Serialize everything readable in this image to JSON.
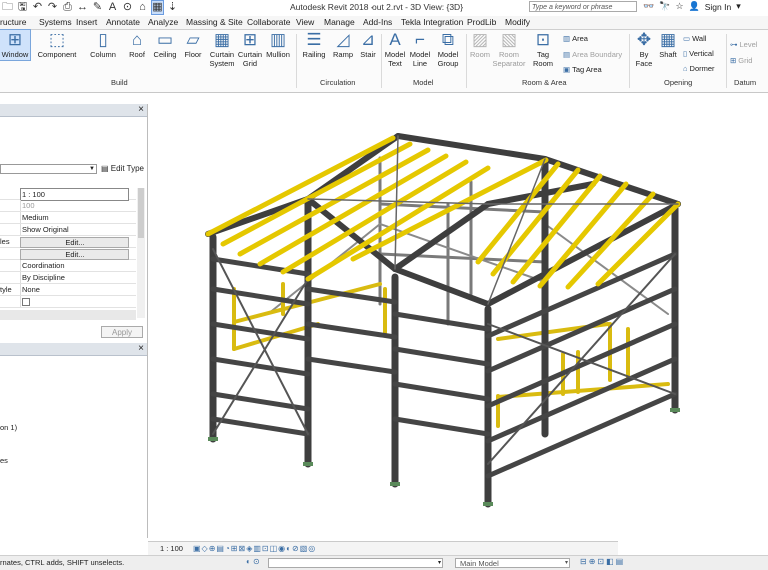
{
  "titlebar": {
    "quick_access": [
      "🗀",
      "🖫",
      "↶",
      "↷",
      "⎙",
      "↔",
      "✎",
      "A",
      "⊙",
      "⌂",
      "▦",
      "⇣"
    ],
    "app_title": "Autodesk Revit 2018 -",
    "doc_title": "out 2.rvt - 3D View: {3D}",
    "search_placeholder": "Type a keyword or phrase",
    "right_icons": [
      "👓",
      "🔭",
      "☆"
    ],
    "user_icon": "👤",
    "sign_in": "Sign In",
    "sign_in_caret": "▾"
  },
  "tabs": [
    "ructure",
    "Systems",
    "Insert",
    "Annotate",
    "Analyze",
    "Massing & Site",
    "Collaborate",
    "View",
    "Manage",
    "Add-Ins",
    "Tekla Integration",
    "ProdLib",
    "Modify"
  ],
  "ribbon": {
    "build": {
      "panel_label": "Build",
      "window": "Window",
      "component": "Component",
      "column": "Column",
      "roof": "Roof",
      "ceiling": "Ceiling",
      "floor": "Floor",
      "curtain_system": [
        "Curtain",
        "System"
      ],
      "curtain_grid": [
        "Curtain",
        "Grid"
      ],
      "mullion": "Mullion"
    },
    "circulation": {
      "panel_label": "Circulation",
      "railing": "Railing",
      "ramp": "Ramp",
      "stair": "Stair"
    },
    "model": {
      "panel_label": "Model",
      "model_text": [
        "Model",
        "Text"
      ],
      "model_line": [
        "Model",
        "Line"
      ],
      "model_group": [
        "Model",
        "Group"
      ]
    },
    "room_area": {
      "panel_label": "Room & Area",
      "room": "Room",
      "room_separator": [
        "Room",
        "Separator"
      ],
      "tag_room": [
        "Tag",
        "Room"
      ],
      "area": "Area",
      "area_boundary": "Area  Boundary",
      "tag_area": "Tag  Area"
    },
    "opening": {
      "panel_label": "Opening",
      "by_face": [
        "By",
        "Face"
      ],
      "shaft": "Shaft",
      "wall": "Wall",
      "vertical": "Vertical",
      "dormer": "Dormer"
    },
    "datum": {
      "panel_label": "Datum",
      "level": "Level",
      "grid": "Grid"
    }
  },
  "properties": {
    "close": "×",
    "edit_type": "Edit Type",
    "rows": [
      {
        "key": "",
        "value": "1 : 100",
        "style": "box"
      },
      {
        "key": "",
        "value": "100",
        "style": "gray"
      },
      {
        "key": "",
        "value": "Medium",
        "style": ""
      },
      {
        "key": "",
        "value": "Show Original",
        "style": ""
      },
      {
        "key": "les",
        "value": "Edit...",
        "style": "btn"
      },
      {
        "key": "",
        "value": "Edit...",
        "style": "btn"
      },
      {
        "key": "",
        "value": "Coordination",
        "style": ""
      },
      {
        "key": "",
        "value": "By Discipline",
        "style": ""
      },
      {
        "key": "tyle",
        "value": "None",
        "style": ""
      },
      {
        "key": "",
        "value": "",
        "style": "check"
      }
    ],
    "apply": "Apply"
  },
  "project_browser": {
    "close": "×",
    "items": [
      "on 1)",
      "",
      "es"
    ]
  },
  "view_control": {
    "scale": "1 : 100",
    "icons": "▣◇⊕▤◔⊞⊠◈▥⊡◫◉◐⊘▧◎"
  },
  "status": {
    "text": "rnates, CTRL adds, SHIFT unselects.",
    "left_icons": "◐ ⊙",
    "workset_caret": "▾",
    "model": "Main Model",
    "model_caret": "▾",
    "right_icons": "⊟⊕⊡◧▤"
  },
  "colors": {
    "steel": "#4a4a4a",
    "yellow": "#e5c800",
    "ribbon_blue": "#3b6ea5"
  }
}
